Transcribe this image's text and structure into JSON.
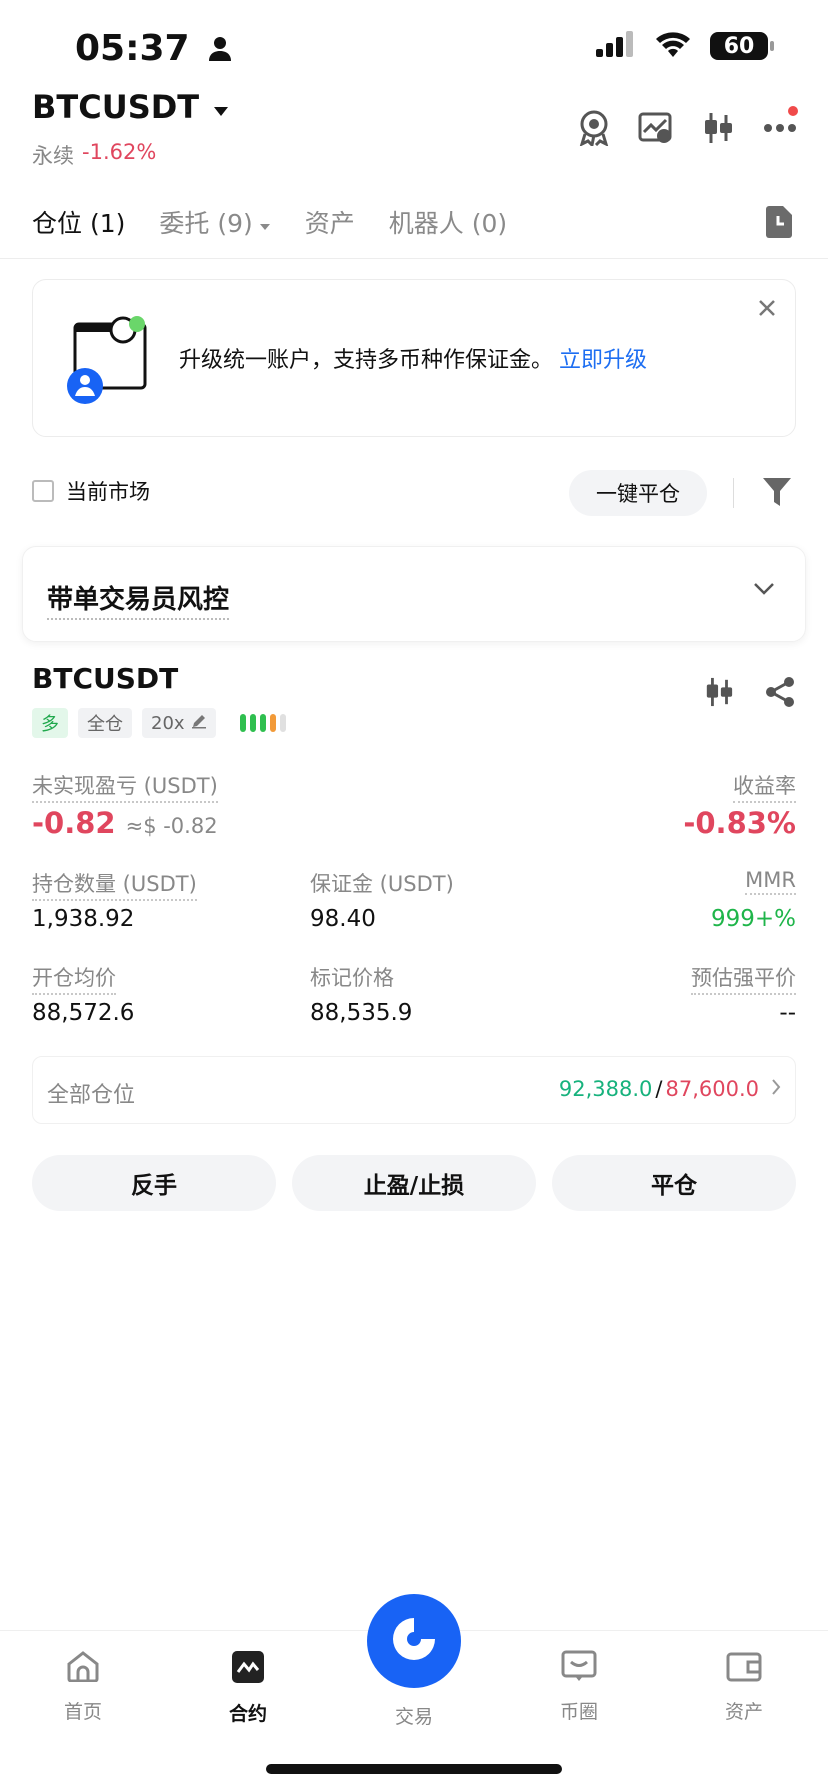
{
  "status_bar": {
    "time": "05:37",
    "battery": "60"
  },
  "header": {
    "symbol": "BTCUSDT",
    "contract_type": "永续",
    "change_pct": "-1.62%"
  },
  "tabs": [
    {
      "label": "仓位 (1)",
      "active": true
    },
    {
      "label": "委托 (9)",
      "active": false,
      "dropdown": true
    },
    {
      "label": "资产",
      "active": false
    },
    {
      "label": "机器人 (0)",
      "active": false
    }
  ],
  "banner": {
    "text": "升级统一账户，支持多币种作保证金。",
    "link": "立即升级"
  },
  "filter": {
    "current_market_label": "当前市场",
    "close_all_label": "一键平仓"
  },
  "risk_section": {
    "title": "带单交易员风控"
  },
  "position": {
    "symbol": "BTCUSDT",
    "side": "多",
    "margin_mode": "全仓",
    "leverage": "20x",
    "leverage_bar_colors": [
      "#2fbf4f",
      "#2fbf4f",
      "#2fbf4f",
      "#f29a38",
      "#e0e0e0"
    ],
    "unrealized_pnl_label": "未实现盈亏 (USDT)",
    "unrealized_pnl": "-0.82",
    "unrealized_pnl_usd": "≈$ -0.82",
    "roe_label": "收益率",
    "roe": "-0.83%",
    "size_label": "持仓数量 (USDT)",
    "size": "1,938.92",
    "margin_label": "保证金 (USDT)",
    "margin": "98.40",
    "mmr_label": "MMR",
    "mmr": "999+%",
    "entry_label": "开仓均价",
    "entry": "88,572.6",
    "mark_label": "标记价格",
    "mark": "88,535.9",
    "liq_label": "预估强平价",
    "liq": "--"
  },
  "all_positions": {
    "label": "全部仓位",
    "long_value": "92,388.0",
    "separator": "/",
    "short_value": "87,600.0"
  },
  "actions": {
    "reverse": "反手",
    "tpsl": "止盈/止损",
    "close": "平仓"
  },
  "bottom_nav": [
    {
      "label": "首页",
      "icon": "home-icon"
    },
    {
      "label": "合约",
      "icon": "futures-icon",
      "active": true
    },
    {
      "label": "交易",
      "icon": "trade-icon"
    },
    {
      "label": "币圈",
      "icon": "community-icon"
    },
    {
      "label": "资产",
      "icon": "wallet-icon"
    }
  ],
  "colors": {
    "up": "#1fb54a",
    "down": "#e0465e",
    "accent": "#1863f5",
    "link": "#1d6ef2"
  }
}
